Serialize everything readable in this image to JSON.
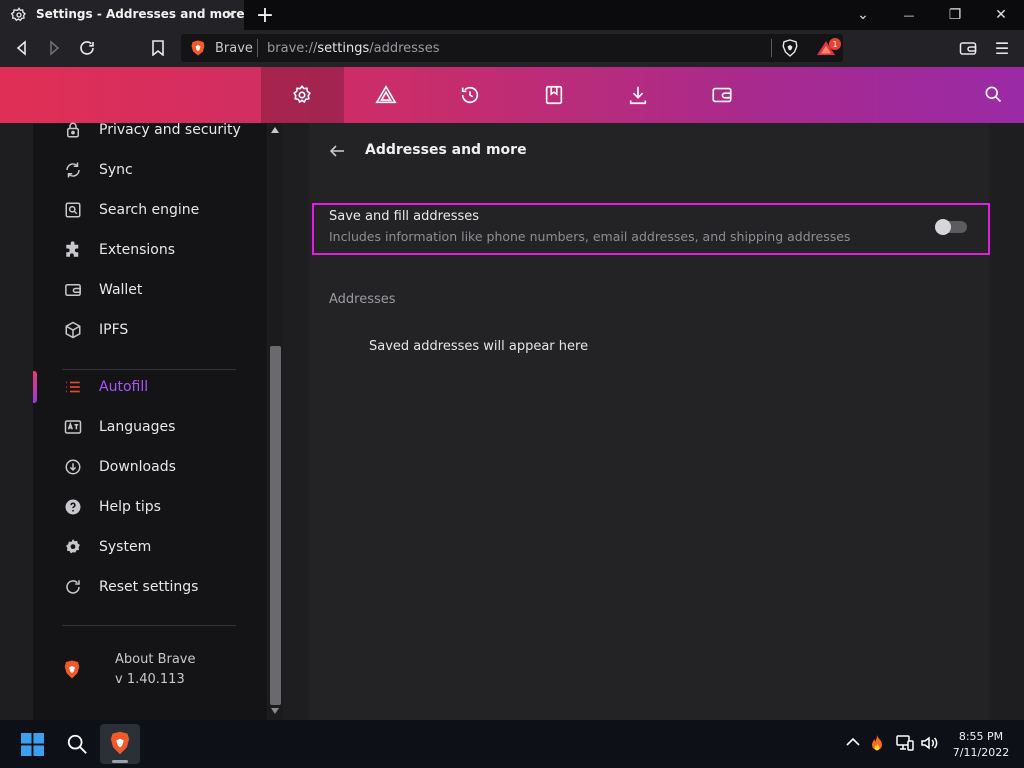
{
  "window": {
    "tab_title": "Settings - Addresses and more",
    "new_tab": "+",
    "controls": {
      "minimize": "⌄",
      "maximize": "—",
      "restore": "❐",
      "close": "✕"
    }
  },
  "omnibox": {
    "site_name": "Brave",
    "url_scheme": "brave://",
    "url_host": "settings",
    "url_path": "/addresses",
    "rewards_badge": "1"
  },
  "toolbar": {
    "items": [
      "settings",
      "rewards",
      "history",
      "bookmarks",
      "downloads",
      "wallet"
    ],
    "active": "settings"
  },
  "sidebar": {
    "items": [
      {
        "label": "Privacy and security",
        "icon": "lock-icon"
      },
      {
        "label": "Sync",
        "icon": "sync-icon"
      },
      {
        "label": "Search engine",
        "icon": "search-engine-icon"
      },
      {
        "label": "Extensions",
        "icon": "puzzle-icon"
      },
      {
        "label": "Wallet",
        "icon": "wallet-icon"
      },
      {
        "label": "IPFS",
        "icon": "cube-icon"
      },
      {
        "label": "Autofill",
        "icon": "list-icon",
        "active": true
      },
      {
        "label": "Languages",
        "icon": "language-icon"
      },
      {
        "label": "Downloads",
        "icon": "download-icon"
      },
      {
        "label": "Help tips",
        "icon": "help-icon"
      },
      {
        "label": "System",
        "icon": "gear-icon"
      },
      {
        "label": "Reset settings",
        "icon": "reset-icon"
      }
    ],
    "about_label": "About Brave",
    "version": "v 1.40.113"
  },
  "main": {
    "title": "Addresses and more",
    "save_fill": {
      "title": "Save and fill addresses",
      "description": "Includes information like phone numbers, email addresses, and shipping addresses",
      "enabled": false
    },
    "addresses_header": "Addresses",
    "empty_message": "Saved addresses will appear here"
  },
  "taskbar": {
    "time": "8:55 PM",
    "date": "7/11/2022"
  },
  "colors": {
    "accent_pink": "#e02f55",
    "accent_purple": "#9a2aa6",
    "highlight_border": "#e01ee0",
    "autofill_active": "#a855f7"
  }
}
